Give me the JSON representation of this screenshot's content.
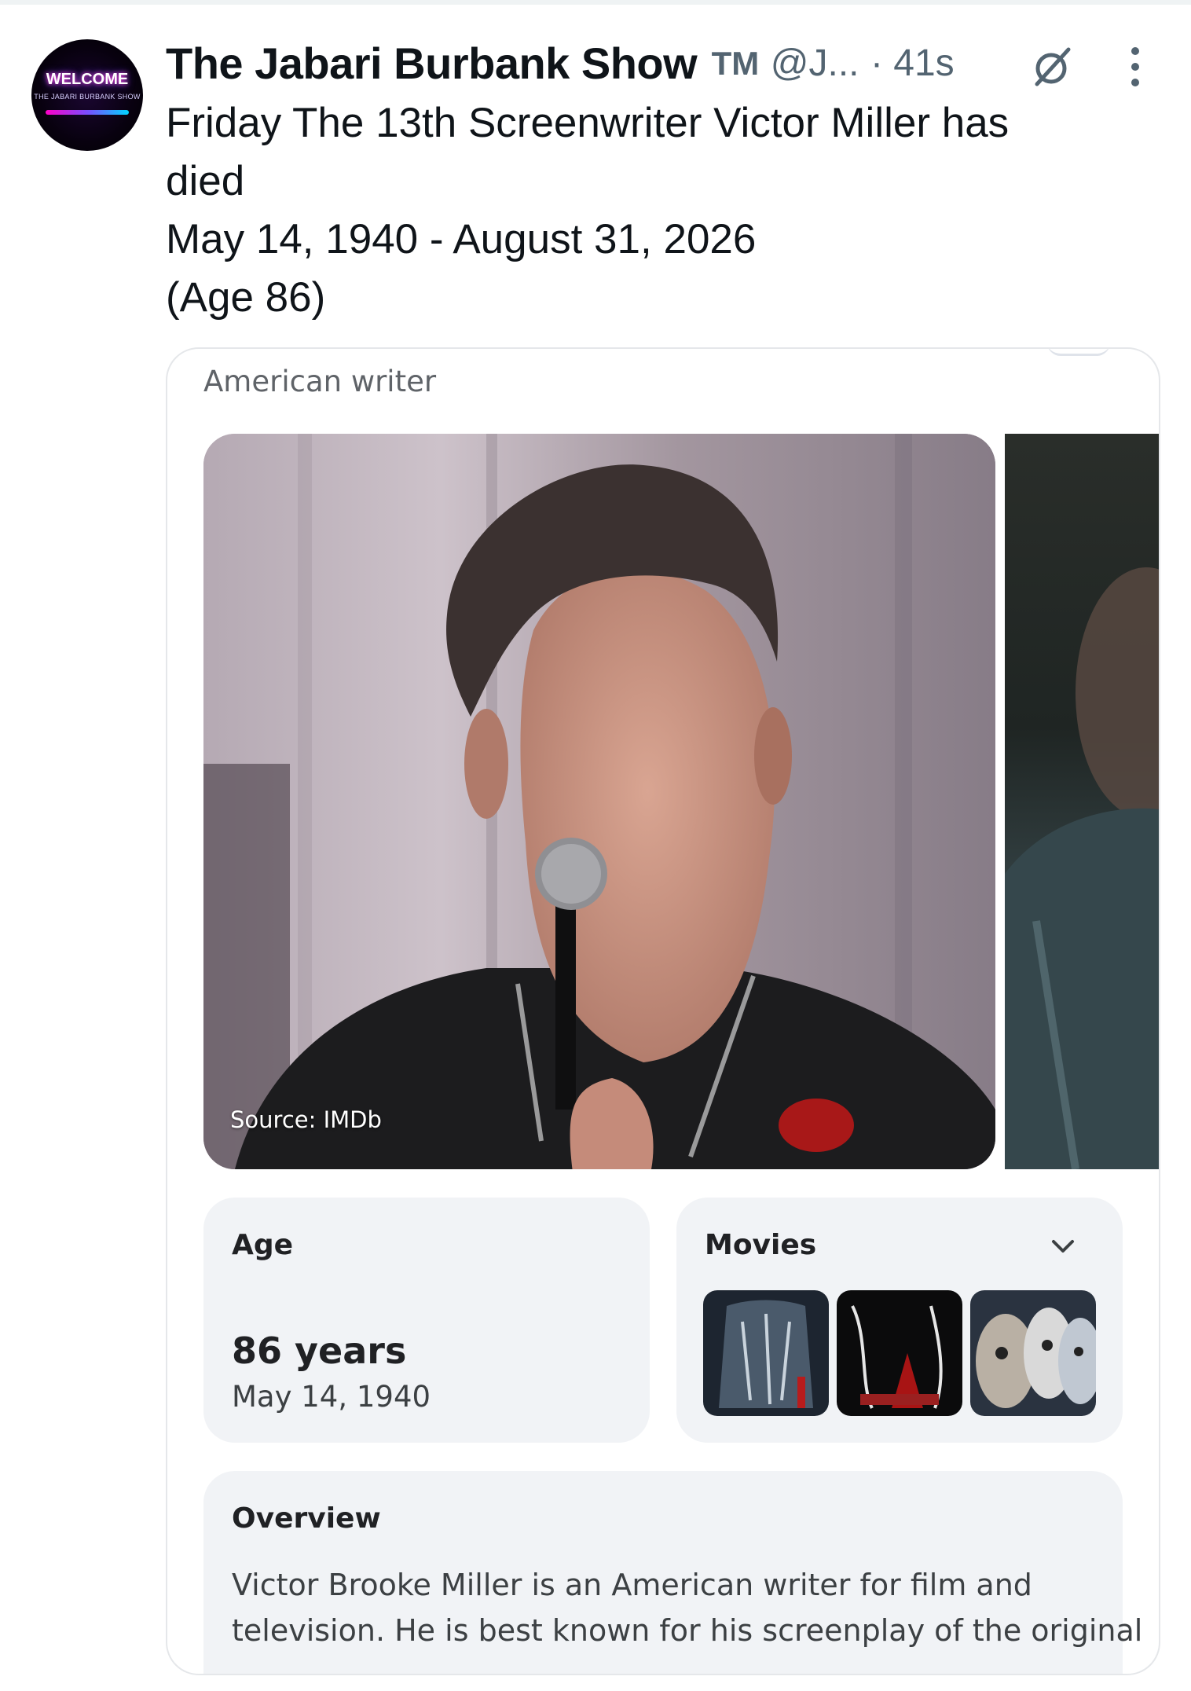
{
  "post": {
    "author": {
      "avatar_text": "WELCOME",
      "avatar_subtext": "THE JABARI BURBANK SHOW",
      "display_name": "The Jabari Burbank Show",
      "badge": "TM",
      "handle": "@J...",
      "time": "· 41s"
    },
    "text_lines": [
      "Friday The 13th Screenwriter Victor Miller has",
      "died",
      "May 14, 1940 - August 31, 2026",
      "(Age 86)"
    ]
  },
  "card": {
    "label": "American writer",
    "photo_source": "Source: IMDb",
    "age": {
      "title": "Age",
      "value": "86 years",
      "birth_date": "May 14, 1940"
    },
    "movies": {
      "title": "Movies",
      "posters": [
        "movie-poster-1",
        "movie-poster-2",
        "movie-poster-3"
      ]
    },
    "overview": {
      "title": "Overview",
      "lines": [
        "Victor Brooke Miller is an American writer for film and",
        "television. He is best known for his screenplay of the original"
      ]
    }
  },
  "colors": {
    "text": "#0f1419",
    "secondary": "#536471",
    "tile_bg": "#f1f3f6",
    "card_border": "#e5e7ea"
  },
  "icons": [
    "grok-icon",
    "more-icon",
    "chevron-down-icon"
  ]
}
